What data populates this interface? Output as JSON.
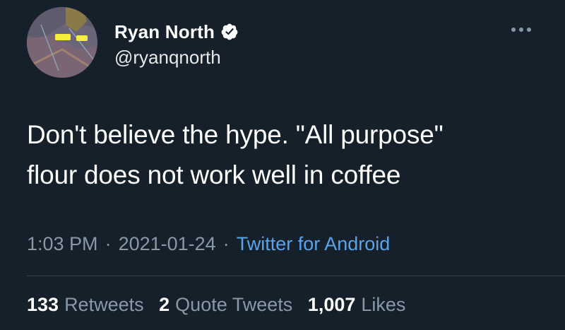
{
  "author": {
    "display_name": "Ryan North",
    "handle": "@ryanqnorth",
    "verified_icon": "verified-badge-icon",
    "avatar_icon": "avatar"
  },
  "tweet": {
    "text_lines": [
      "Don't believe the hype. \"All purpose\"",
      "flour does not work well in coffee"
    ]
  },
  "meta": {
    "time": "1:03 PM",
    "date": "2021-01-24",
    "separator": "·",
    "source": "Twitter for Android"
  },
  "stats": {
    "retweets_count": "133",
    "retweets_label": "Retweets",
    "quote_count": "2",
    "quote_label": "Quote Tweets",
    "likes_count": "1,007",
    "likes_label": "Likes"
  },
  "menu_icon": "more-options-icon",
  "colors": {
    "background": "#15202b",
    "text": "#ffffff",
    "secondary": "#8899a6",
    "link": "#5aa3e8",
    "divider": "#38444d"
  }
}
